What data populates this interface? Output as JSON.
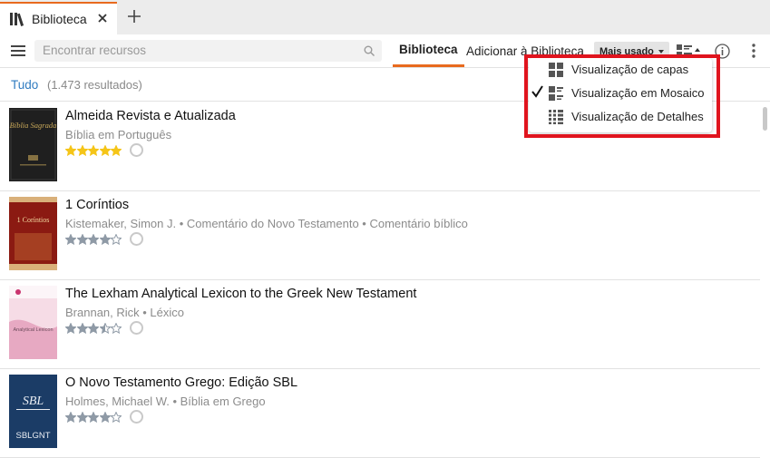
{
  "tab": {
    "title": "Biblioteca",
    "accent": "#e86a1e"
  },
  "toolbar": {
    "search_placeholder": "Encontrar recursos",
    "nav_library": "Biblioteca",
    "nav_add": "Adicionar à Biblioteca",
    "sort_label": "Mais usado"
  },
  "filter": {
    "all": "Tudo",
    "count": "(1.473 resultados)"
  },
  "menu": {
    "items": [
      {
        "label": "Visualização de capas",
        "icon": "cover-view-icon",
        "checked": false
      },
      {
        "label": "Visualização em Mosaico",
        "icon": "tile-view-icon",
        "checked": true
      },
      {
        "label": "Visualização de Detalhes",
        "icon": "details-view-icon",
        "checked": false
      }
    ],
    "highlight_color": "#e0141e"
  },
  "items": [
    {
      "title": "Almeida Revista e Atualizada",
      "meta": "Bíblia em Português",
      "rating": 5,
      "star_color": "#f5c518",
      "cover": {
        "bg": "#1f1f1f",
        "text": "Bíblia Sagrada"
      }
    },
    {
      "title": "1 Coríntios",
      "meta": "Kistemaker, Simon J. • Comentário do Novo Testamento • Comentário bíblico",
      "rating": 4,
      "star_color": "#8f9aa6",
      "cover": {
        "bg": "#8b1a12",
        "text": "1 Coríntios"
      }
    },
    {
      "title": "The Lexham Analytical Lexicon to the Greek New Testament",
      "meta": "Brannan, Rick • Léxico",
      "rating": 3.5,
      "star_color": "#8f9aa6",
      "cover": {
        "bg": "#f6dce6",
        "text": "Analytical Lexicon"
      }
    },
    {
      "title": "O Novo Testamento Grego: Edição SBL",
      "meta": "Holmes, Michael W. • Bíblia em Grego",
      "rating": 4,
      "star_color": "#8f9aa6",
      "cover": {
        "bg": "#1b3c66",
        "text": "SBLGNT",
        "logo": "SBL"
      }
    }
  ]
}
